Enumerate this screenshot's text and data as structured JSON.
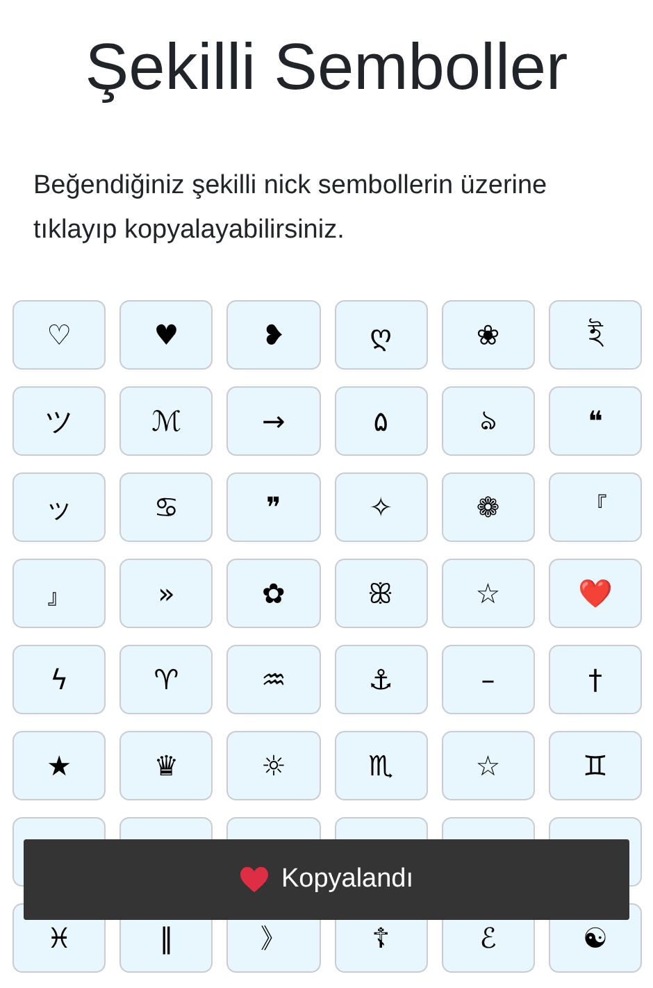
{
  "title": "Şekilli Semboller",
  "intro": "Beğendiğiniz şekilli nick sembollerin üzerine tıklayıp kopyalayabilirsiniz.",
  "rows": [
    [
      {
        "symbol": "♡"
      },
      {
        "symbol": "♥"
      },
      {
        "symbol": "❥"
      },
      {
        "symbol": "ღ"
      },
      {
        "symbol": "❀"
      },
      {
        "symbol": "ই"
      }
    ],
    [
      {
        "symbol": "ツ"
      },
      {
        "symbol": "ℳ"
      },
      {
        "symbol": "→"
      },
      {
        "symbol": "۵"
      },
      {
        "symbol": "ঌ"
      },
      {
        "symbol": "❝"
      }
    ],
    [
      {
        "symbol": "ッ"
      },
      {
        "symbol": "♋"
      },
      {
        "symbol": "❞"
      },
      {
        "symbol": "✧"
      },
      {
        "symbol": "❁"
      },
      {
        "symbol": "『"
      }
    ],
    [
      {
        "symbol": "』"
      },
      {
        "symbol": "»"
      },
      {
        "symbol": "✿"
      },
      {
        "symbol": "ꕥ"
      },
      {
        "symbol": "☆"
      },
      {
        "symbol": "❤️"
      }
    ],
    [
      {
        "symbol": "ϟ"
      },
      {
        "symbol": "♈"
      },
      {
        "symbol": "♒"
      },
      {
        "symbol": "⚓"
      },
      {
        "symbol": "–"
      },
      {
        "symbol": "†"
      }
    ],
    [
      {
        "symbol": "★"
      },
      {
        "symbol": "♛"
      },
      {
        "symbol": "☼"
      },
      {
        "symbol": "♏"
      },
      {
        "symbol": "☆"
      },
      {
        "symbol": "♊"
      }
    ],
    [
      {
        "covered": true
      },
      {
        "covered": true
      },
      {
        "covered": true
      },
      {
        "covered": true
      },
      {
        "covered": true
      },
      {
        "covered": true
      }
    ],
    [
      {
        "symbol": "♓"
      },
      {
        "symbol": "‖"
      },
      {
        "symbol": "》"
      },
      {
        "symbol": "☦"
      },
      {
        "symbol": "ℰ"
      },
      {
        "symbol": "☯"
      }
    ]
  ],
  "toast": {
    "message": "Kopyalandı"
  }
}
